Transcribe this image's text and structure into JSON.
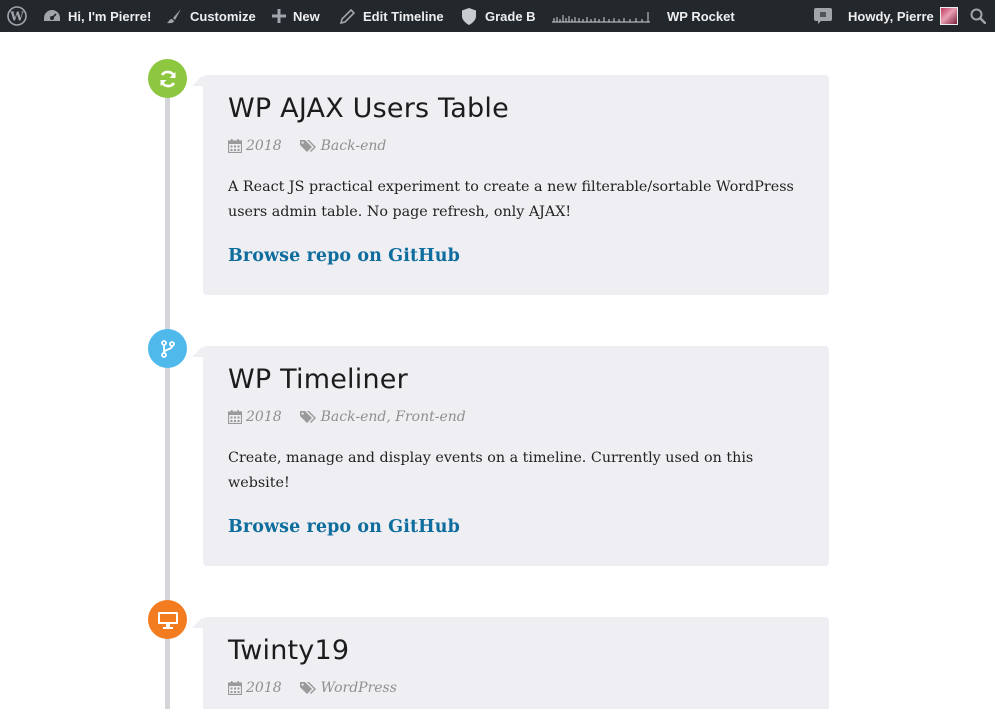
{
  "admin_bar": {
    "site_label": "Hi, I'm Pierre!",
    "customize_label": "Customize",
    "new_label": "New",
    "edit_label": "Edit Timeline",
    "grade_label": "Grade B",
    "rocket_label": "WP Rocket",
    "howdy_label": "Howdy, Pierre",
    "icons": [
      "wordpress-logo-icon",
      "dashboard-icon",
      "brush-icon",
      "plus-icon",
      "pencil-icon",
      "shield-icon",
      "sparkline-icon",
      "comment-icon",
      "avatar",
      "search-icon"
    ]
  },
  "timeline": [
    {
      "title": "WP AJAX Users Table",
      "year": "2018",
      "tags": "Back-end",
      "description": "A React JS practical experiment to create a new filterable/sortable WordPress users admin table. No page refresh, only AJAX!",
      "link_label": "Browse repo on GitHub",
      "marker_icon": "refresh-icon",
      "marker_color": "#8dc63f"
    },
    {
      "title": "WP Timeliner",
      "year": "2018",
      "tags": "Back-end, Front-end",
      "description": "Create, manage and display events on a timeline. Currently used on this website!",
      "link_label": "Browse repo on GitHub",
      "marker_icon": "code-branch-icon",
      "marker_color": "#4fb9ec"
    },
    {
      "title": "Twinty19",
      "year": "2018",
      "tags": "WordPress",
      "marker_icon": "desktop-icon",
      "marker_color": "#f47c20"
    }
  ],
  "colors": {
    "admin_bar_bg": "#23282d",
    "card_bg": "#efeff3",
    "link": "#0f6d9e",
    "timeline_line": "#d4d5d9"
  }
}
